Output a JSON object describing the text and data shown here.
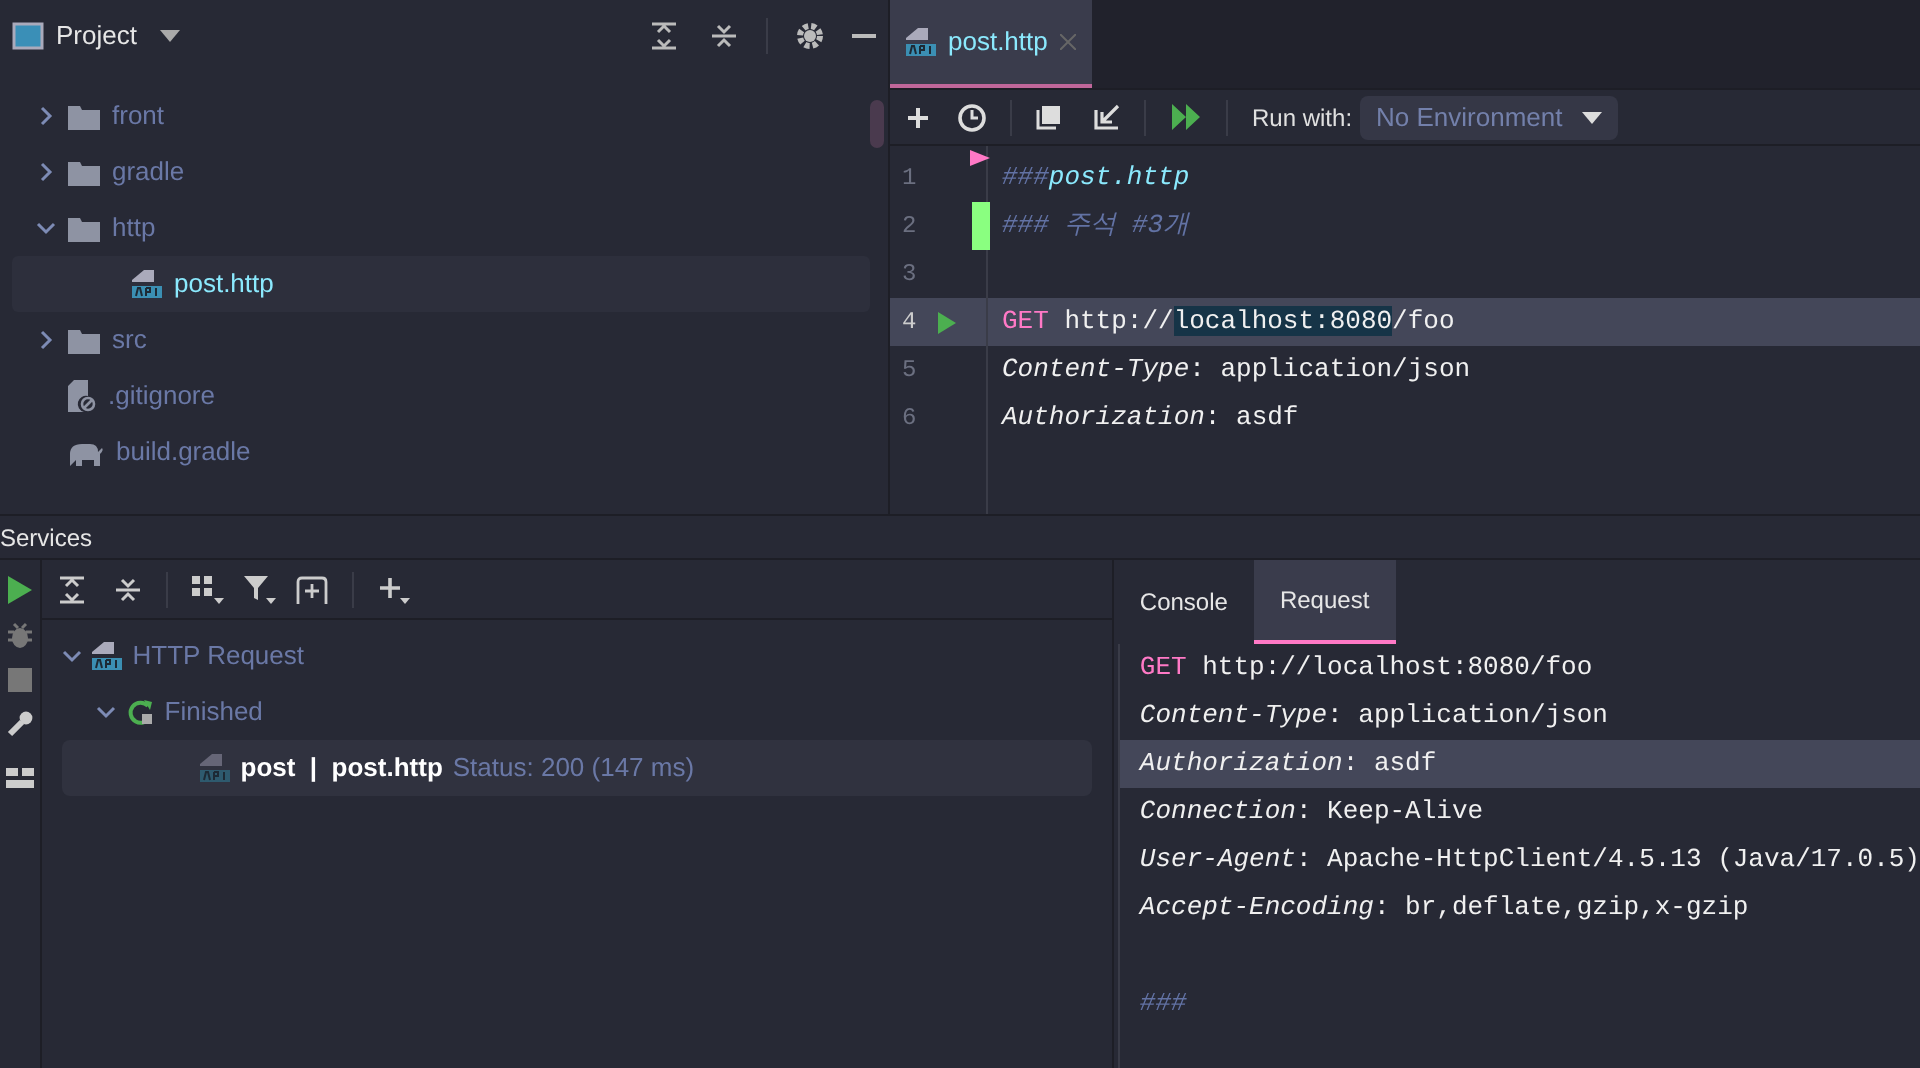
{
  "project": {
    "title": "Project",
    "tree": [
      {
        "label": "front",
        "kind": "folder",
        "expanded": false,
        "selected": false
      },
      {
        "label": "gradle",
        "kind": "folder",
        "expanded": false,
        "selected": false
      },
      {
        "label": "http",
        "kind": "folder",
        "expanded": true,
        "selected": false,
        "children": [
          {
            "label": "post.http",
            "kind": "api",
            "selected": true
          }
        ]
      },
      {
        "label": "src",
        "kind": "folder",
        "expanded": false,
        "selected": false
      },
      {
        "label": ".gitignore",
        "kind": "ignore",
        "selected": false
      },
      {
        "label": "build.gradle",
        "kind": "gradle",
        "selected": false
      }
    ]
  },
  "editor": {
    "tabs": [
      {
        "label": "post.http",
        "selected": true
      }
    ],
    "run_with_label": "Run with:",
    "environment": "No Environment",
    "lines": [
      {
        "number": "1",
        "current": false,
        "changed": false,
        "segments": [
          {
            "kind": "comment",
            "text": "###"
          },
          {
            "kind": "title",
            "text": "post.http"
          }
        ]
      },
      {
        "number": "2",
        "current": false,
        "changed": true,
        "segments": [
          {
            "kind": "comment",
            "text": "### 주석 #3개"
          }
        ]
      },
      {
        "number": "3",
        "current": false,
        "changed": false
      },
      {
        "number": "4",
        "current": true,
        "changed": false,
        "segments": [
          {
            "kind": "method",
            "text": "GET"
          },
          {
            "kind": "plain",
            "text": " http://"
          },
          {
            "kind": "match",
            "text": "localhost:8080"
          },
          {
            "kind": "plain",
            "text": "/foo"
          }
        ]
      },
      {
        "number": "5",
        "current": false,
        "changed": false,
        "segments": [
          {
            "kind": "key",
            "text": "Content-Type"
          },
          {
            "kind": "plain",
            "text": ": application/json"
          }
        ]
      },
      {
        "number": "6",
        "current": false,
        "changed": false,
        "segments": [
          {
            "kind": "key",
            "text": "Authorization"
          },
          {
            "kind": "plain",
            "text": ": asdf"
          }
        ]
      }
    ]
  },
  "services": {
    "title": "Services",
    "tree": [
      {
        "label": "HTTP Request",
        "kind": "group",
        "expanded": true,
        "selected": false,
        "children": [
          {
            "label": "Finished",
            "kind": "status",
            "expanded": true,
            "selected": false,
            "children": [
              {
                "label": "post  |  post.http",
                "status": "Status: 200 (147 ms)",
                "kind": "request",
                "selected": true
              }
            ]
          }
        ]
      }
    ]
  },
  "request_panel": {
    "tabs": [
      {
        "label": "Console",
        "selected": false
      },
      {
        "label": "Request",
        "selected": true
      }
    ],
    "lines": [
      {
        "current": false,
        "segments": [
          {
            "kind": "method",
            "text": "GET"
          },
          {
            "kind": "plain",
            "text": " http://localhost:8080/foo"
          }
        ]
      },
      {
        "current": false,
        "segments": [
          {
            "kind": "key",
            "text": "Content-Type"
          },
          {
            "kind": "plain",
            "text": ": application/json"
          }
        ]
      },
      {
        "current": true,
        "segments": [
          {
            "kind": "key",
            "text": "Authorization"
          },
          {
            "kind": "plain",
            "text": ": asdf"
          }
        ]
      },
      {
        "current": false,
        "segments": [
          {
            "kind": "key",
            "text": "Connection"
          },
          {
            "kind": "plain",
            "text": ": Keep-Alive"
          }
        ]
      },
      {
        "current": false,
        "segments": [
          {
            "kind": "key",
            "text": "User-Agent"
          },
          {
            "kind": "plain",
            "text": ": Apache-HttpClient/4.5.13 (Java/17.0.5)"
          }
        ]
      },
      {
        "current": false,
        "segments": [
          {
            "kind": "key",
            "text": "Accept-Encoding"
          },
          {
            "kind": "plain",
            "text": ": br,deflate,gzip,x-gzip"
          }
        ]
      },
      {
        "current": false,
        "kind": "separator",
        "segments": [
          {
            "kind": "comment",
            "text": "###"
          }
        ]
      }
    ]
  }
}
